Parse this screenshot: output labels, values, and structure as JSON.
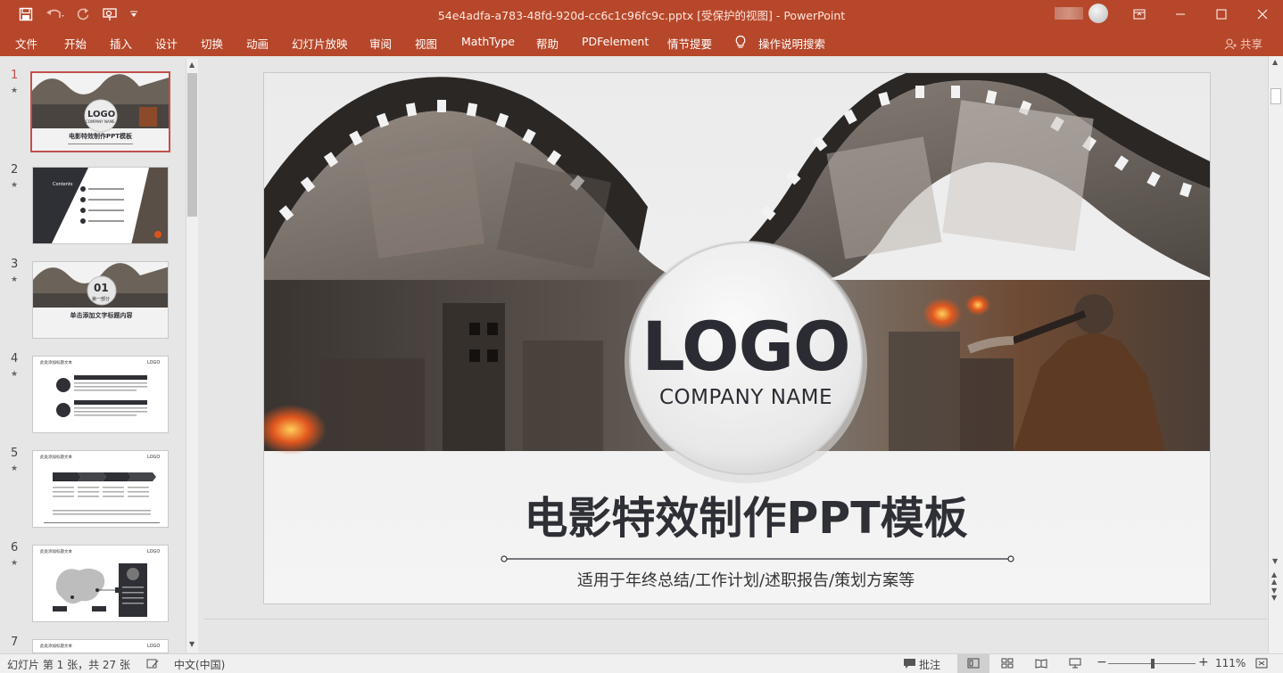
{
  "app": {
    "title": "54e4adfa-a783-48fd-920d-cc6c1c96fc9c.pptx [受保护的视图]  -  PowerPoint"
  },
  "quick_access": {
    "icons": [
      "save-icon",
      "undo-icon",
      "redo-icon",
      "present-from-start-icon",
      "customize-qat-icon"
    ]
  },
  "ribbon": {
    "tabs": [
      "文件",
      "开始",
      "插入",
      "设计",
      "切换",
      "动画",
      "幻灯片放映",
      "审阅",
      "视图",
      "MathType",
      "帮助",
      "PDFelement",
      "情节提要"
    ],
    "tell_me": "操作说明搜索",
    "share": "共享"
  },
  "thumbnails": [
    {
      "num": "1",
      "star": "★",
      "title": "电影特效制作PPT模板",
      "logo": "LOGO",
      "company": "COMPANY NAME"
    },
    {
      "num": "2",
      "star": "★",
      "title": "Contents"
    },
    {
      "num": "3",
      "star": "★",
      "badge": "01",
      "sub": "第一部分",
      "title": "单击添加文字标题内容"
    },
    {
      "num": "4",
      "star": "★",
      "header": "此处添加标题文本",
      "logo": "LOGO"
    },
    {
      "num": "5",
      "star": "★",
      "header": "此处添加标题文本",
      "logo": "LOGO"
    },
    {
      "num": "6",
      "star": "★",
      "header": "此处添加标题文本",
      "logo": "LOGO"
    },
    {
      "num": "7",
      "star": "",
      "header": "此处添加标题文本",
      "logo": "LOGO"
    }
  ],
  "slide": {
    "logo": "LOGO",
    "company": "COMPANY NAME",
    "title": "电影特效制作PPT模板",
    "subtitle": "适用于年终总结/工作计划/述职报告/策划方案等"
  },
  "status": {
    "slide_info": "幻灯片 第 1 张，共 27 张",
    "language": "中文(中国)",
    "notes": "批注",
    "zoom": "111%"
  },
  "colors": {
    "accent": "#b7472a",
    "slide_text": "#2f3036",
    "active_border": "#c0504d"
  }
}
